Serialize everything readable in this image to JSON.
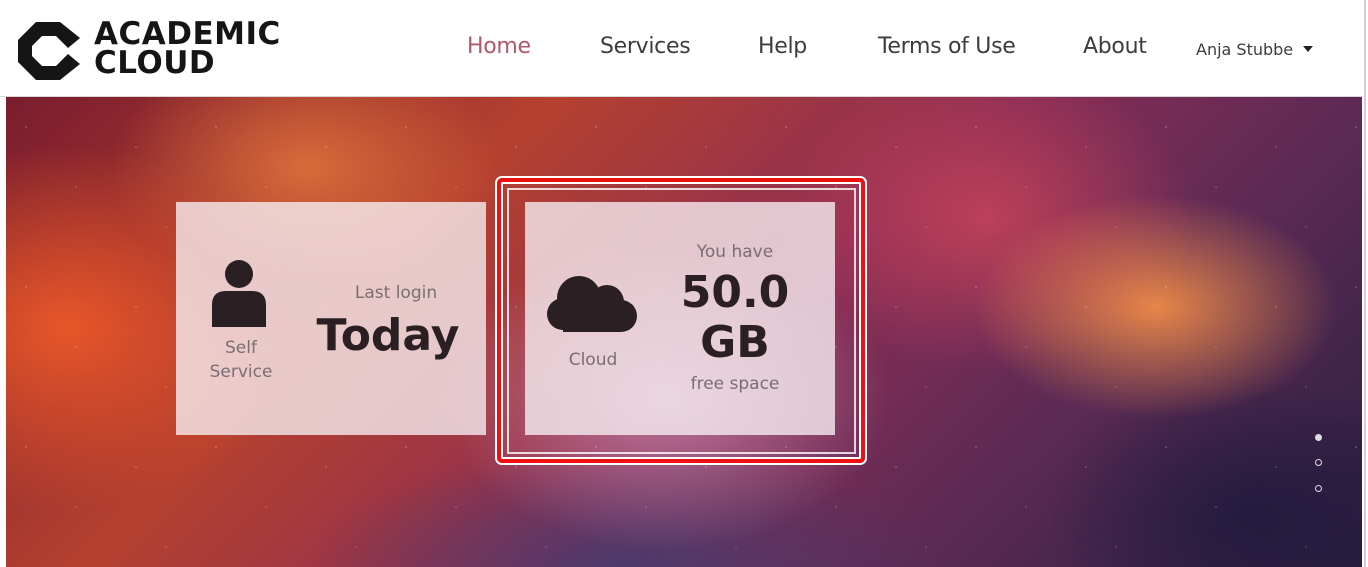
{
  "brand": {
    "line1": "ACADEMIC",
    "line2": "CLOUD"
  },
  "nav": {
    "items": [
      {
        "label": "Home",
        "active": true
      },
      {
        "label": "Services"
      },
      {
        "label": "Help"
      },
      {
        "label": "Terms of Use"
      },
      {
        "label": "About"
      }
    ],
    "user_name": "Anja Stubbe"
  },
  "tiles": [
    {
      "icon": "person-icon",
      "label_line1": "Self",
      "label_line2": "Service",
      "caption": "Last login",
      "value": "Today"
    },
    {
      "icon": "cloud-icon",
      "label": "Cloud",
      "caption_top": "You have",
      "value_line1": "50.0",
      "value_line2": "GB",
      "caption_bottom": "free space",
      "highlighted": true
    }
  ],
  "carousel": {
    "dots": 3,
    "active_index": 0
  },
  "colors": {
    "active_nav": "#b2566a",
    "highlight": "#ee1111",
    "text_dark": "#2a1f22"
  }
}
